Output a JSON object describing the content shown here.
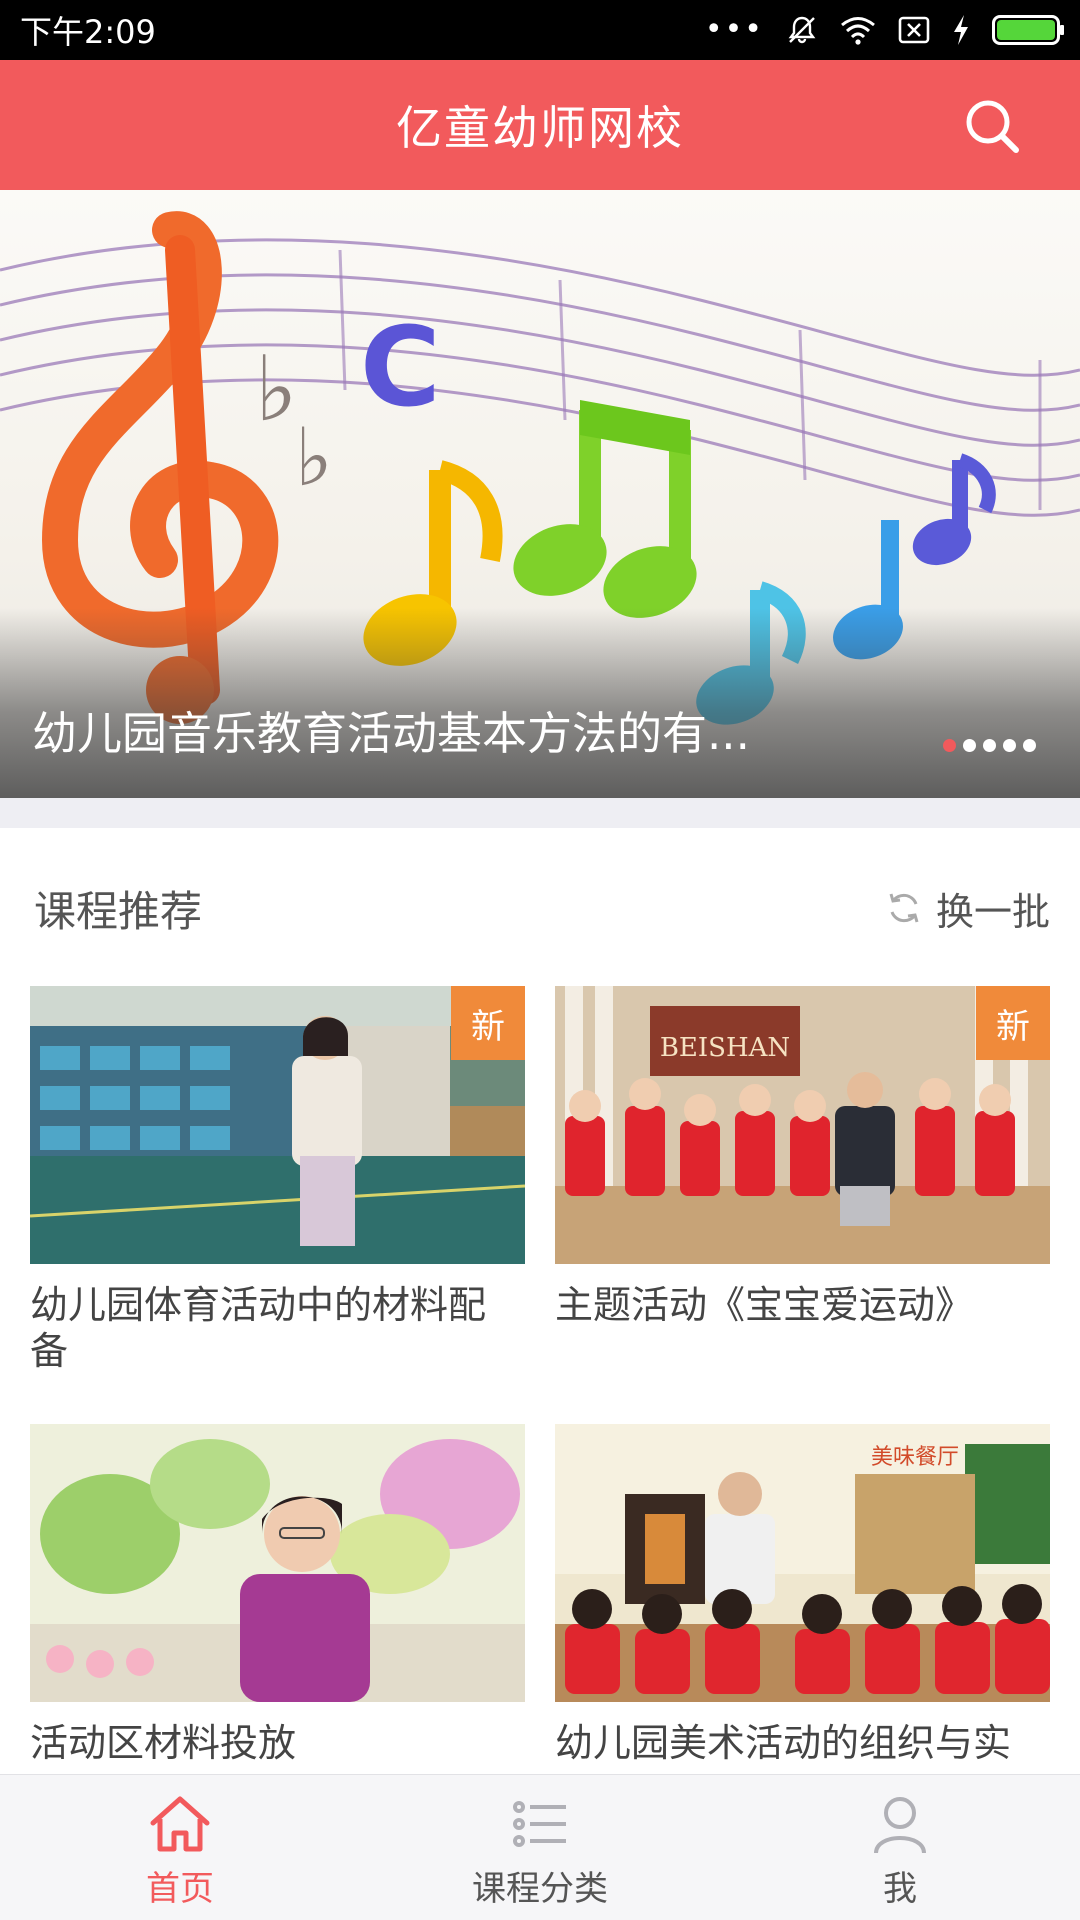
{
  "status_bar": {
    "time": "下午2:09",
    "icons": [
      "more-dots-icon",
      "mute-icon",
      "wifi-icon",
      "no-sim-icon",
      "charging-icon",
      "battery-icon"
    ]
  },
  "header": {
    "title": "亿童幼师网校",
    "search_icon": "search-icon"
  },
  "banner": {
    "caption": "幼儿园音乐教育活动基本方法的有...",
    "slide_count": 5,
    "active_slide": 1
  },
  "section": {
    "title": "课程推荐",
    "refresh_label": "换一批",
    "refresh_icon": "refresh-icon"
  },
  "courses": [
    {
      "title": "幼儿园体育活动中的材料配备",
      "badge": "新"
    },
    {
      "title": "主题活动《宝宝爱运动》",
      "badge": "新"
    },
    {
      "title": "活动区材料投放",
      "badge": ""
    },
    {
      "title": "幼儿园美术活动的组织与实",
      "badge": ""
    }
  ],
  "bottom_nav": [
    {
      "label": "首页",
      "icon": "home-icon",
      "active": true
    },
    {
      "label": "课程分类",
      "icon": "list-icon",
      "active": false
    },
    {
      "label": "我",
      "icon": "profile-icon",
      "active": false
    }
  ],
  "colors": {
    "brand": "#f25a5c",
    "badge": "#f08a3a",
    "section_gap": "#eeeef3"
  }
}
